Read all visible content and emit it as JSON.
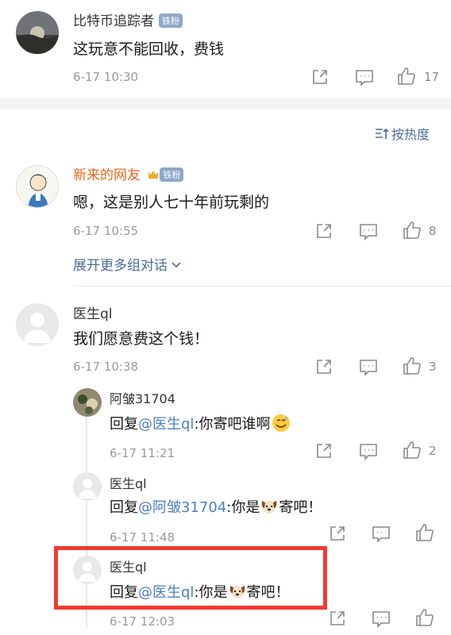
{
  "comments": [
    {
      "author": "比特币追踪者",
      "badge": "铁粉",
      "text": "这玩意不能回收，费钱",
      "time": "6-17 10:30",
      "likes": "17"
    },
    {
      "author": "新来的网友",
      "badge": "铁粉",
      "text": "嗯，这是别人七十年前玩剩的",
      "time": "6-17 10:55",
      "likes": "8",
      "expand_label": "展开更多组对话"
    },
    {
      "author": "医生ql",
      "text": "我们愿意费这个钱！",
      "time": "6-17 10:38",
      "likes": "3"
    }
  ],
  "sort_label": "按热度",
  "replies": [
    {
      "author": "阿皱31704",
      "prefix": "回复",
      "mention": "@医生ql",
      "text": ":你寄吧谁啊",
      "time": "6-17 11:21",
      "likes": "2"
    },
    {
      "author": "医生ql",
      "prefix": "回复",
      "mention": "@阿皱31704",
      "text_a": ":你是",
      "text_b": "寄吧！",
      "time": "6-17 11:48"
    },
    {
      "author": "医生ql",
      "prefix": "回复",
      "mention": "@医生ql",
      "text_a": ":你是",
      "text_b": "寄吧！",
      "time": "6-17 12:03"
    }
  ],
  "colors": {
    "mention": "#4a7fc1",
    "highlight": "#f23a2e",
    "orange_name": "#e8661c",
    "badge": "#8ea8c8"
  }
}
